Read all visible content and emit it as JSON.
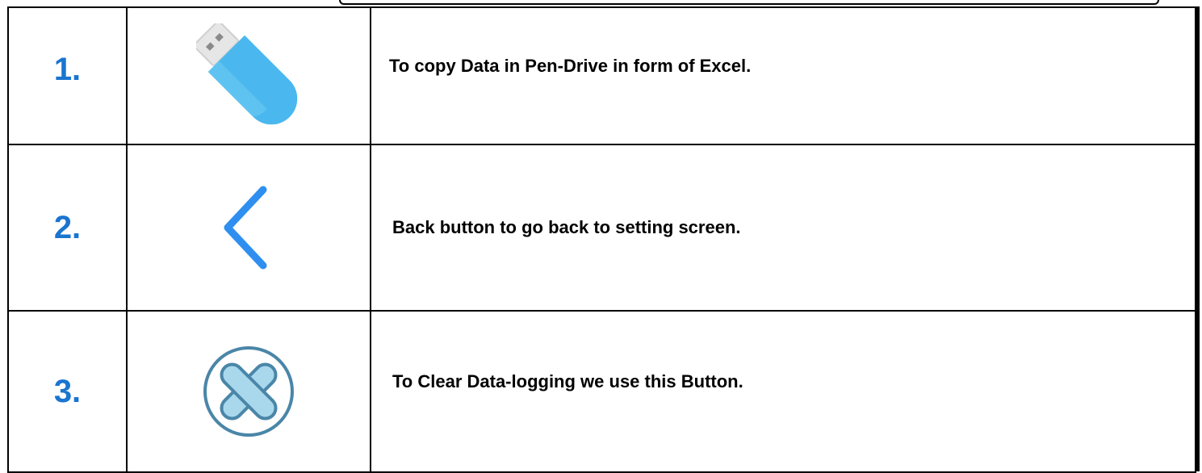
{
  "rows": [
    {
      "number": "1.",
      "icon": "usb-drive-icon",
      "description": "To copy Data in Pen-Drive in form of Excel."
    },
    {
      "number": "2.",
      "icon": "chevron-left-icon",
      "description": "Back button to go back to setting screen."
    },
    {
      "number": "3.",
      "icon": "clear-x-circle-icon",
      "description": "To Clear Data-logging we use this Button."
    }
  ],
  "colors": {
    "number": "#1a75cf",
    "usb": "#4ab8ee",
    "chevron": "#2f8ff0",
    "clear_fill": "#a9d8ec",
    "clear_ring": "#4a86a8"
  }
}
